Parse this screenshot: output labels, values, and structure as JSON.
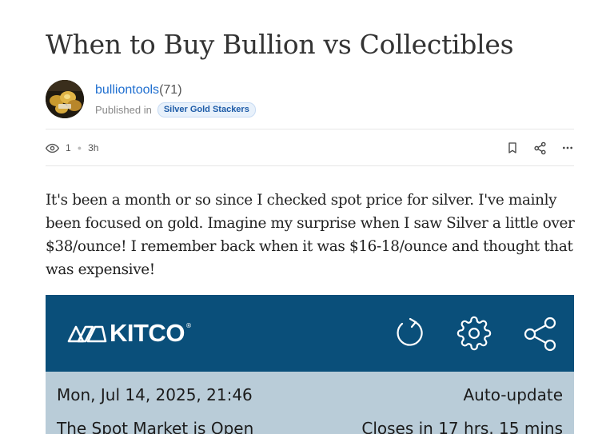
{
  "post": {
    "title": "When to Buy Bullion vs Collectibles",
    "body": "It's been a month or so since I checked spot price for silver. I've mainly been focused on gold. Imagine my surprise when I saw Silver a little over $38/ounce! I remember back when it was $16-18/ounce and thought that was expensive!"
  },
  "author": {
    "name": "bulliontools",
    "reputation": "(71)",
    "published_label": "Published in",
    "community": "Silver Gold Stackers"
  },
  "meta": {
    "views": "1",
    "age": "3h",
    "icons": [
      "eye-icon",
      "bookmark-icon",
      "share-icon",
      "more-icon"
    ]
  },
  "kitco": {
    "logo_text": "KITCO",
    "logo_mark": "®",
    "date": "Mon, Jul 14, 2025, 21:46",
    "auto_update": "Auto-update",
    "market_status": "The Spot Market is Open",
    "closes": "Closes in 17 hrs. 15 mins",
    "icons": [
      "refresh-icon",
      "settings-icon",
      "share-icon"
    ],
    "colors": {
      "header": "#0a4f7a",
      "panel": "#b9ccd8"
    }
  },
  "colors": {
    "link": "#1f6fd0",
    "badge_bg": "#e8f1fb",
    "badge_text": "#1e5ca8"
  }
}
